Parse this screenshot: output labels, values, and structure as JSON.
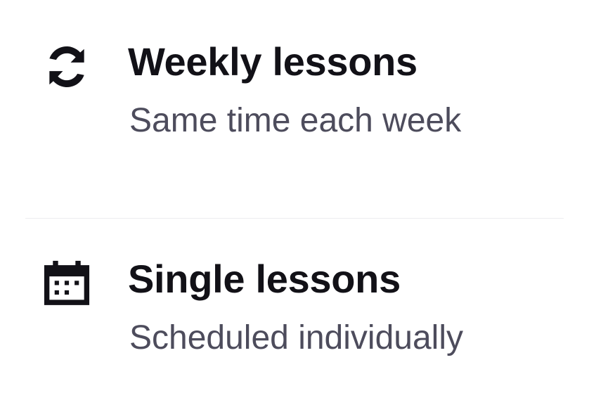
{
  "options": [
    {
      "title": "Weekly lessons",
      "subtitle": "Same time each week",
      "icon": "refresh-icon"
    },
    {
      "title": "Single lessons",
      "subtitle": "Scheduled individually",
      "icon": "calendar-icon"
    }
  ],
  "colors": {
    "title": "#121117",
    "subtitle": "#4d4c5c",
    "divider": "#ececf0",
    "background": "#ffffff"
  }
}
